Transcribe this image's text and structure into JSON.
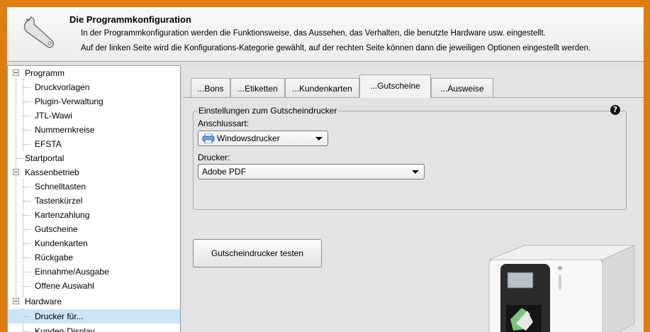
{
  "header": {
    "title": "Die Programmkonfiguration",
    "line1": "In der Programmkonfiguration werden die Funktionsweise, das Aussehen, das Verhalten, die benutzte Hardware usw. eingestellt.",
    "line2": "Auf der linken Seite wird die Konfigurations-Kategorie gewählt, auf der rechten Seite können dann die jeweiligen Optionen eingestellt werden.",
    "icon": "wrench-icon"
  },
  "tree": {
    "programm": "Programm",
    "druckvorlagen": "Druckvorlagen",
    "plugin": "Plugin-Verwaltung",
    "jtl": "JTL-Wawi",
    "nummernkreise": "Nummernkreise",
    "efsta": "EFSTA",
    "startportal": "Startportal",
    "kassenbetrieb": "Kassenbetrieb",
    "schnelltasten": "Schnelltasten",
    "tastenkuerzel": "Tastenkürzel",
    "kartenzahlung": "Kartenzahlung",
    "gutscheine": "Gutscheine",
    "kundenkarten": "Kundenkarten",
    "rueckgabe": "Rückgabe",
    "einnahme": "Einnahme/Ausgabe",
    "offene": "Offene Auswahl",
    "hardware": "Hardware",
    "drucker": "Drucker für...",
    "kunden_display": "Kunden-Display"
  },
  "tabs": {
    "bons": "...Bons",
    "etiketten": "...Etiketten",
    "kundenkarten": "...Kundenkarten",
    "gutscheine": "...Gutscheine",
    "ausweise": "...Ausweise",
    "active": "...Gutscheine"
  },
  "group": {
    "legend": "Einstellungen zum Gutscheindrucker",
    "help_icon": "?"
  },
  "anschluss": {
    "label": "Anschlussart:",
    "value": "Windowsdrucker"
  },
  "drucker": {
    "label": "Drucker:",
    "value": "Adobe PDF"
  },
  "test_button": "Gutscheindrucker testen",
  "colors": {
    "frame": "#e07d10",
    "selection": "#cce4f7"
  }
}
